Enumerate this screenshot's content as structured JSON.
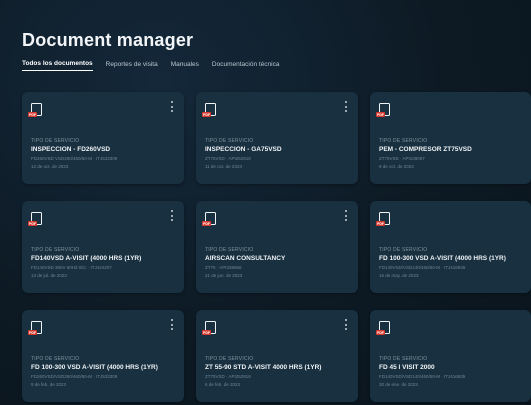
{
  "page": {
    "title": "Document manager"
  },
  "tabs": [
    {
      "label": "Todos los documentos",
      "active": true
    },
    {
      "label": "Reportes de visita",
      "active": false
    },
    {
      "label": "Manuales",
      "active": false
    },
    {
      "label": "Documentación técnica",
      "active": false
    }
  ],
  "cards": [
    {
      "service_label": "TIPO DE SERVICIO",
      "name": "INSPECCION - FD260VSD",
      "meta": "FD260VSD VSD260/460/50-M · ITJ533309",
      "date": "12 de oct. de 2023",
      "icon": "pdf-icon"
    },
    {
      "service_label": "TIPO DE SERVICIO",
      "name": "INSPECCION - GA75VSD",
      "meta": "ZT75VSD · API252918",
      "date": "11 de oct. de 2023",
      "icon": "pdf-icon"
    },
    {
      "service_label": "TIPO DE SERVICIO",
      "name": "PEM - COMPRESOR ZT75VSD",
      "meta": "ZT75VSD · API109097",
      "date": "9 de oct. de 2023",
      "icon": "pdf-icon"
    },
    {
      "service_label": "TIPO DE SERVICIO",
      "name": "FD140VSD A-VISIT (4000 HRS (1YR)",
      "meta": "FD140VSD 380V 60HZ IEC · ITJ424207",
      "date": "13 de jul. de 2023",
      "icon": "pdf-icon"
    },
    {
      "service_label": "TIPO DE SERVICIO",
      "name": "AIRSCAN CONSULTANCY",
      "meta": "ZT75 · API338566",
      "date": "21 de jun. de 2023",
      "icon": "pdf-icon"
    },
    {
      "service_label": "TIPO DE SERVICIO",
      "name": "FD 100-300 VSD A-VISIT (4000 HRS (1YR)",
      "meta": "FD140VSD/VSD140/460/50-M · ITJ416935",
      "date": "16 de may. de 2023",
      "icon": "pdf-icon"
    },
    {
      "service_label": "TIPO DE SERVICIO",
      "name": "FD 100-300 VSD A-VISIT (4000 HRS (1YR)",
      "meta": "FD260VSD/VSD260/460/50-M · ITJ533309",
      "date": "9 de feb. de 2023",
      "icon": "pdf-icon"
    },
    {
      "service_label": "TIPO DE SERVICIO",
      "name": "ZT 55-90 STD A-VISIT 4000 HRS (1YR)",
      "meta": "ZT75VSD · API252918",
      "date": "6 de feb. de 2023",
      "icon": "pdf-icon"
    },
    {
      "service_label": "TIPO DE SERVICIO",
      "name": "FD 45 I VISIT 2000",
      "meta": "FD140VSD/VSD140/460/50-M · ITJ416935",
      "date": "30 de ene. de 2023",
      "icon": "pdf-icon"
    }
  ]
}
